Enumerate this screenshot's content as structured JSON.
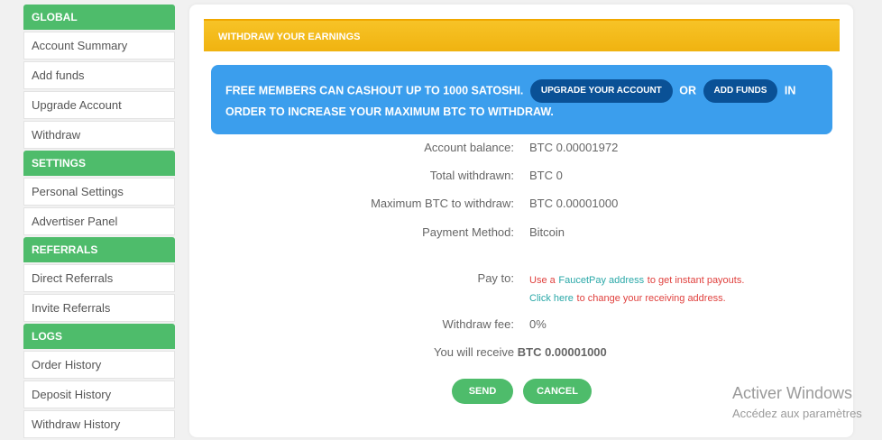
{
  "sidebar": {
    "sections": [
      {
        "title": "GLOBAL",
        "items": [
          "Account Summary",
          "Add funds",
          "Upgrade Account",
          "Withdraw"
        ]
      },
      {
        "title": "SETTINGS",
        "items": [
          "Personal Settings",
          "Advertiser Panel"
        ]
      },
      {
        "title": "REFERRALS",
        "items": [
          "Direct Referrals",
          "Invite Referrals"
        ]
      },
      {
        "title": "LOGS",
        "items": [
          "Order History",
          "Deposit History",
          "Withdraw History"
        ]
      }
    ]
  },
  "main": {
    "header": "WITHDRAW YOUR EARNINGS",
    "notice": {
      "text1": "FREE MEMBERS CAN CASHOUT UP TO 1000 SATOSHI.",
      "upgrade_btn": "UPGRADE YOUR ACCOUNT",
      "or": "OR",
      "add_funds_btn": "ADD FUNDS",
      "text2": "IN",
      "text3": "ORDER TO INCREASE YOUR MAXIMUM BTC TO WITHDRAW."
    },
    "rows": {
      "balance_label": "Account balance:",
      "balance_value": "BTC 0.00001972",
      "withdrawn_label": "Total withdrawn:",
      "withdrawn_value": "BTC 0",
      "max_label": "Maximum BTC to withdraw:",
      "max_value": "BTC 0.00001000",
      "method_label": "Payment Method:",
      "method_value": "Bitcoin",
      "payto_label": "Pay to:",
      "payto_1a": "Use a",
      "payto_1b": "FaucetPay address",
      "payto_1c": "to get instant payouts.",
      "payto_2a": "Click here",
      "payto_2b": "to change your receiving address.",
      "fee_label": "Withdraw fee:",
      "fee_value": "0%",
      "receive_label": "You will receive",
      "receive_value": "BTC 0.00001000"
    },
    "buttons": {
      "send": "SEND",
      "cancel": "CANCEL"
    }
  },
  "watermark": {
    "line1": "Activer Windows",
    "line2": "Accédez aux paramètres"
  },
  "colors": {
    "green": "#4ebc6b",
    "orange": "#f0b310",
    "blue": "#3b9eed",
    "navy": "#0a5196",
    "red": "#e0413e",
    "teal": "#2aa8a8"
  }
}
